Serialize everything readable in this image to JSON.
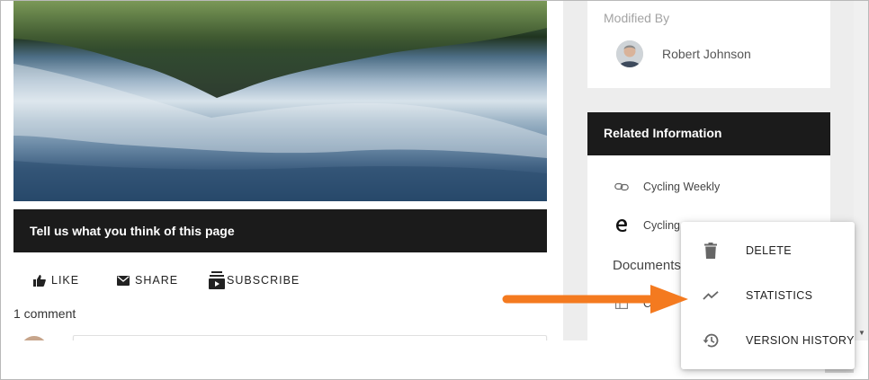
{
  "feedback": {
    "heading": "Tell us what you think of this page"
  },
  "actions": {
    "like": "LIKE",
    "share": "SHARE",
    "subscribe": "SUBSCRIBE"
  },
  "comments": {
    "count_text": "1 comment"
  },
  "modified": {
    "label": "Modified By",
    "name": "Robert Johnson"
  },
  "related": {
    "header": "Related Information",
    "items": [
      {
        "label": "Cycling Weekly",
        "icon": "link-icon"
      },
      {
        "label": "Cycling",
        "icon": "edge-icon"
      }
    ],
    "documents_label": "Documents",
    "doc_items": [
      {
        "label": "Cycli",
        "icon": "document-icon"
      }
    ]
  },
  "menu": {
    "items": [
      {
        "label": "DELETE",
        "icon": "trash-icon"
      },
      {
        "label": "STATISTICS",
        "icon": "trend-icon"
      },
      {
        "label": "VERSION HISTORY",
        "icon": "history-icon"
      }
    ]
  },
  "colors": {
    "dark_header": "#1b1b1b",
    "arrow": "#f47a1f",
    "sidebar_bg": "#ededed"
  }
}
